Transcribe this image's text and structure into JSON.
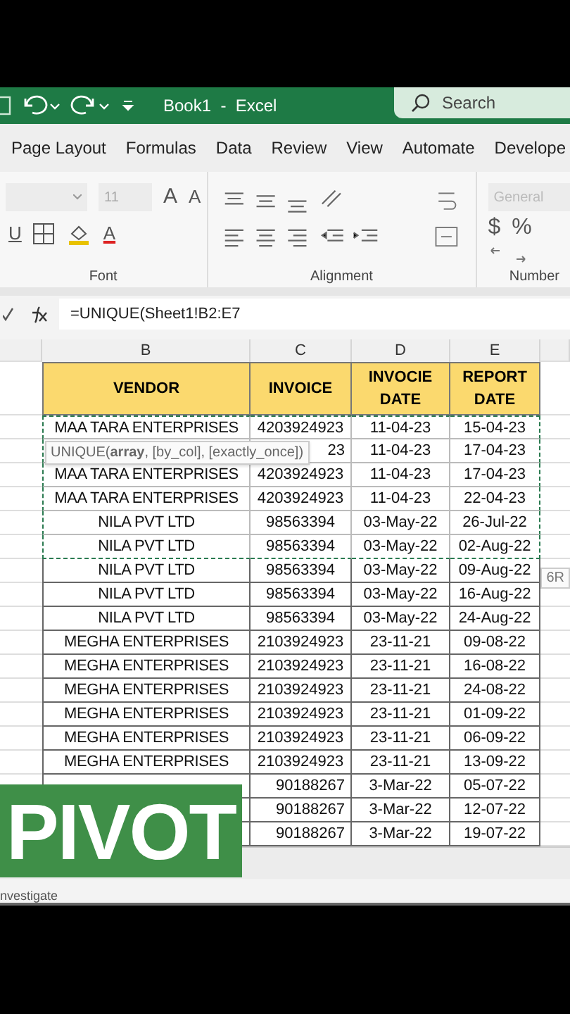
{
  "title_bar": {
    "title": "Book1  -  Excel",
    "search_placeholder": "Search"
  },
  "ribbon_tabs": [
    "Page Layout",
    "Formulas",
    "Data",
    "Review",
    "View",
    "Automate",
    "Develope"
  ],
  "ribbon": {
    "font": {
      "size": "11",
      "grow": "A",
      "shrink": "A",
      "underline": "U",
      "font_color": "A",
      "label": "Font"
    },
    "alignment": {
      "label": "Alignment"
    },
    "number": {
      "format": "General",
      "currency": "$",
      "percent": "%",
      "label": "Number"
    }
  },
  "formula_bar": {
    "formula": "=UNIQUE(Sheet1!B2:E7"
  },
  "sheet": {
    "columns": [
      "B",
      "C",
      "D",
      "E"
    ],
    "headers": [
      "VENDOR",
      "INVOICE",
      "INVOCIE DATE",
      "REPORT DATE"
    ],
    "rows": [
      {
        "vendor": "MAA TARA ENTERPRISES",
        "invoice": "4203924923",
        "invoice_date": "11-04-23",
        "report_date": "15-04-23",
        "in_copy_range": true
      },
      {
        "invoice": "23",
        "invoice_date": "11-04-23",
        "report_date": "17-04-23",
        "in_copy_range": true
      },
      {
        "vendor": "MAA TARA ENTERPRISES",
        "invoice": "4203924923",
        "invoice_date": "11-04-23",
        "report_date": "17-04-23",
        "in_copy_range": true
      },
      {
        "vendor": "MAA TARA ENTERPRISES",
        "invoice": "4203924923",
        "invoice_date": "11-04-23",
        "report_date": "22-04-23",
        "in_copy_range": true
      },
      {
        "vendor": "NILA PVT LTD",
        "invoice": "98563394",
        "invoice_date": "03-May-22",
        "report_date": "26-Jul-22",
        "in_copy_range": true
      },
      {
        "vendor": "NILA PVT LTD",
        "invoice": "98563394",
        "invoice_date": "03-May-22",
        "report_date": "02-Aug-22",
        "in_copy_range": true
      },
      {
        "vendor": "NILA PVT LTD",
        "invoice": "98563394",
        "invoice_date": "03-May-22",
        "report_date": "09-Aug-22",
        "in_copy_range": false
      },
      {
        "vendor": "NILA PVT LTD",
        "invoice": "98563394",
        "invoice_date": "03-May-22",
        "report_date": "16-Aug-22",
        "in_copy_range": false
      },
      {
        "vendor": "NILA PVT LTD",
        "invoice": "98563394",
        "invoice_date": "03-May-22",
        "report_date": "24-Aug-22",
        "in_copy_range": false
      },
      {
        "vendor": "MEGHA ENTERPRISES",
        "invoice": "2103924923",
        "invoice_date": "23-11-21",
        "report_date": "09-08-22",
        "in_copy_range": false
      },
      {
        "vendor": "MEGHA ENTERPRISES",
        "invoice": "2103924923",
        "invoice_date": "23-11-21",
        "report_date": "16-08-22",
        "in_copy_range": false
      },
      {
        "vendor": "MEGHA ENTERPRISES",
        "invoice": "2103924923",
        "invoice_date": "23-11-21",
        "report_date": "24-08-22",
        "in_copy_range": false
      },
      {
        "vendor": "MEGHA ENTERPRISES",
        "invoice": "2103924923",
        "invoice_date": "23-11-21",
        "report_date": "01-09-22",
        "in_copy_range": false
      },
      {
        "vendor": "MEGHA ENTERPRISES",
        "invoice": "2103924923",
        "invoice_date": "23-11-21",
        "report_date": "06-09-22",
        "in_copy_range": false
      },
      {
        "vendor": "MEGHA ENTERPRISES",
        "invoice": "2103924923",
        "invoice_date": "23-11-21",
        "report_date": "13-09-22",
        "in_copy_range": false
      },
      {
        "invoice": "90188267",
        "invoice_date": "3-Mar-22",
        "report_date": "05-07-22",
        "in_copy_range": false
      },
      {
        "invoice": "90188267",
        "invoice_date": "3-Mar-22",
        "report_date": "12-07-22",
        "in_copy_range": false
      },
      {
        "invoice": "90188267",
        "invoice_date": "3-Mar-22",
        "report_date": "19-07-22",
        "in_copy_range": false
      }
    ],
    "function_tooltip": "UNIQUE(**array**, [by_col], [exactly_once])",
    "size_tooltip": "6R"
  },
  "status_bar": {
    "text": "nvestigate"
  },
  "caption": "PIVOT"
}
